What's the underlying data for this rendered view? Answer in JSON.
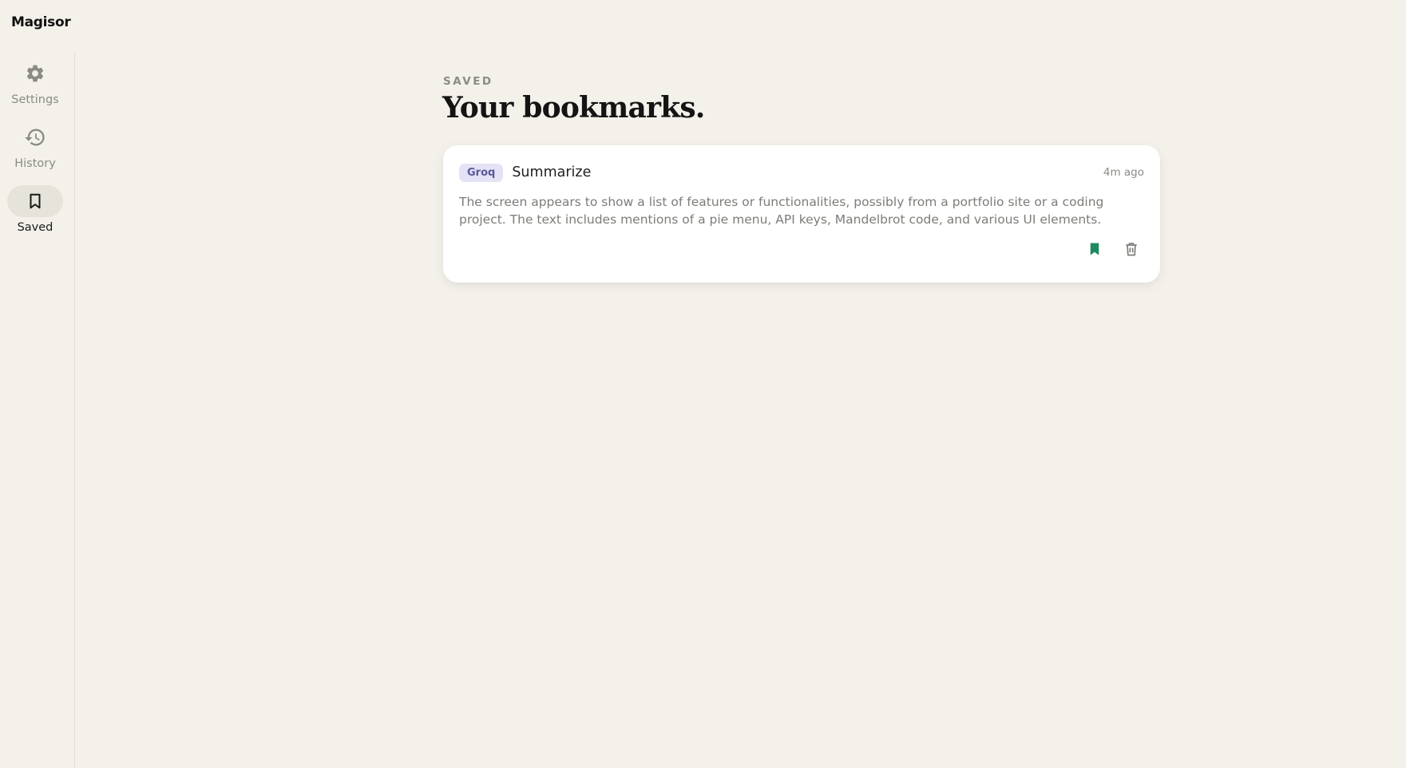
{
  "app": {
    "title": "Magisor"
  },
  "sidebar": {
    "items": [
      {
        "label": "Settings",
        "icon": "gear-icon",
        "active": false
      },
      {
        "label": "History",
        "icon": "history-icon",
        "active": false
      },
      {
        "label": "Saved",
        "icon": "bookmark-icon",
        "active": true
      }
    ]
  },
  "main": {
    "eyebrow": "SAVED",
    "title": "Your bookmarks.",
    "bookmarks": [
      {
        "provider": "Groq",
        "action": "Summarize",
        "time": "4m ago",
        "text": "The screen appears to show a list of features or functionalities, possibly from a portfolio site or a coding project. The text includes mentions of a pie menu, API keys, Mandelbrot code, and various UI elements.",
        "bookmarked": true
      }
    ]
  },
  "colors": {
    "background": "#f3f1ea",
    "badge_bg": "#e4e2f6",
    "badge_text": "#5b5a97",
    "bookmark_active": "#1e8a60",
    "muted": "#8b8a86"
  }
}
